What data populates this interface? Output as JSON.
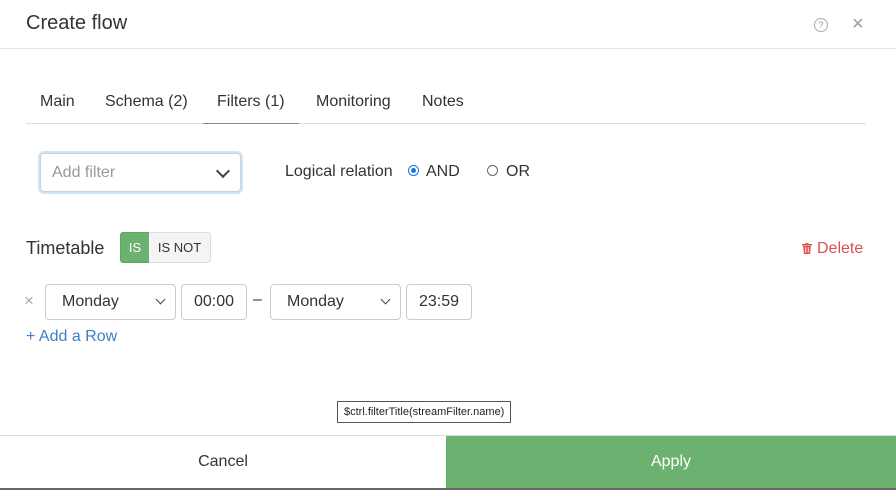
{
  "dialog": {
    "title": "Create flow"
  },
  "tabs": [
    {
      "label": "Main",
      "active": false
    },
    {
      "label": "Schema (2)",
      "active": false
    },
    {
      "label": "Filters (1)",
      "active": true
    },
    {
      "label": "Monitoring",
      "active": false
    },
    {
      "label": "Notes",
      "active": false
    }
  ],
  "filter": {
    "add_placeholder": "Add filter",
    "logical_relation_label": "Logical relation",
    "options": [
      "AND",
      "OR"
    ],
    "selected": "AND"
  },
  "timetable": {
    "label": "Timetable",
    "is_label": "IS",
    "is_not_label": "IS NOT",
    "selected_mode": "IS",
    "delete_label": "Delete",
    "rows": [
      {
        "from_day": "Monday",
        "from_time": "00:00",
        "separator": "–",
        "to_day": "Monday",
        "to_time": "23:59"
      }
    ],
    "add_row_label": "+ Add a Row"
  },
  "tooltip": {
    "text": "$ctrl.filterTitle(streamFilter.name)"
  },
  "footer": {
    "cancel_label": "Cancel",
    "apply_label": "Apply"
  },
  "colors": {
    "accent_green": "#6db170",
    "danger": "#d9534f",
    "link": "#3f7fc4",
    "radio": "#1a73e8"
  }
}
